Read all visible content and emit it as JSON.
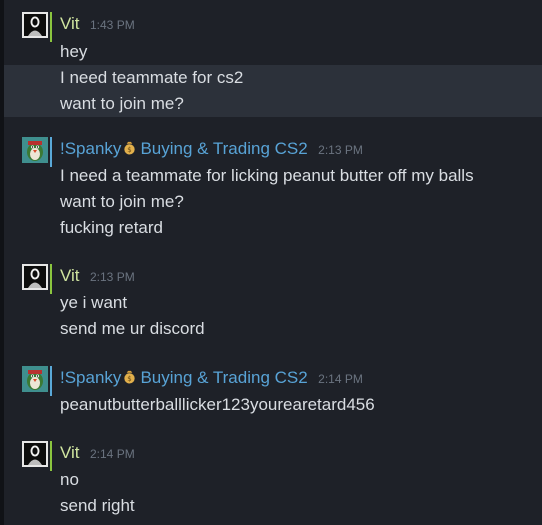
{
  "messages": [
    {
      "author": "Vit",
      "time": "1:43 PM",
      "lines": [
        "hey",
        "I need teammate for cs2",
        "want to join me?"
      ]
    },
    {
      "author": "!Spanky",
      "author_suffix": "Buying & Trading CS2",
      "time": "2:13 PM",
      "lines": [
        "I need a teammate for licking peanut butter off my balls",
        "want to join me?",
        "fucking retard"
      ]
    },
    {
      "author": "Vit",
      "time": "2:13 PM",
      "lines": [
        "ye i want",
        "send me ur discord"
      ]
    },
    {
      "author": "!Spanky",
      "author_suffix": "Buying & Trading CS2",
      "time": "2:14 PM",
      "lines": [
        "peanutbutterballlicker123yourearetard456"
      ]
    },
    {
      "author": "Vit",
      "time": "2:14 PM",
      "lines": [
        "no",
        "send right"
      ]
    }
  ],
  "colors": {
    "background": "#1e2128",
    "highlight_row": "#2c313a",
    "vit_name": "#d0e5a0",
    "spanky_name": "#58a3d6",
    "online_status": "#5aa9d9",
    "ingame_status": "#8bc53f",
    "timestamp": "#6b7480",
    "message_text": "#d9dde2"
  },
  "icons": {
    "vit_avatar": "dark-figure-avatar-icon",
    "spanky_avatar": "penguin-avatar-icon",
    "money": "money-bag-icon"
  }
}
